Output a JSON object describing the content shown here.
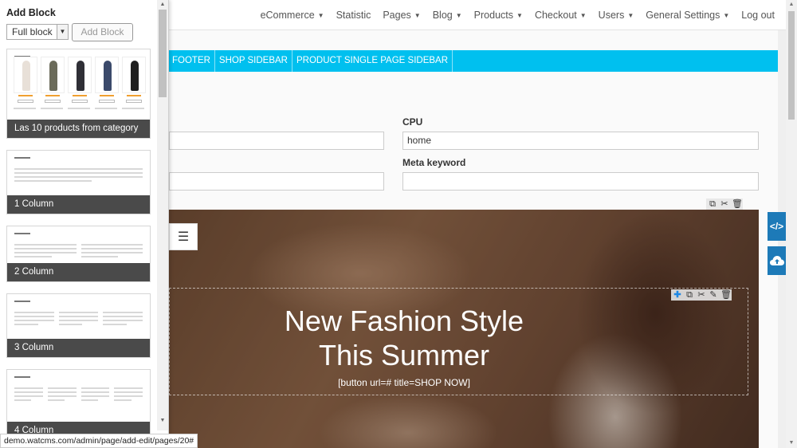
{
  "topnav": {
    "items": [
      {
        "label": "eCommerce",
        "dropdown": true
      },
      {
        "label": "Statistic",
        "dropdown": false
      },
      {
        "label": "Pages",
        "dropdown": true
      },
      {
        "label": "Blog",
        "dropdown": true
      },
      {
        "label": "Products",
        "dropdown": true
      },
      {
        "label": "Checkout",
        "dropdown": true
      },
      {
        "label": "Users",
        "dropdown": true
      },
      {
        "label": "General Settings",
        "dropdown": true
      },
      {
        "label": "Log out",
        "dropdown": false
      }
    ]
  },
  "tabs": [
    "FOOTER",
    "SHOP SIDEBAR",
    "PRODUCT SINGLE PAGE SIDEBAR"
  ],
  "form": {
    "cpu_label": "CPU",
    "cpu_value": "home",
    "meta_keyword_label": "Meta keyword",
    "meta_keyword_value": ""
  },
  "hero": {
    "title_line1": "New Fashion Style",
    "title_line2": "This Summer",
    "shortcode": "[button url=# title=SHOP NOW]"
  },
  "panel": {
    "title": "Add Block",
    "select_value": "Full block",
    "add_button": "Add Block",
    "blocks": [
      {
        "caption": "Las 10 products from category",
        "kind": "products"
      },
      {
        "caption": "1 Column",
        "kind": "columns",
        "columns": 1
      },
      {
        "caption": "2 Column",
        "kind": "columns",
        "columns": 2
      },
      {
        "caption": "3 Column",
        "kind": "columns",
        "columns": 3
      },
      {
        "caption": "4 Column",
        "kind": "columns",
        "columns": 4
      }
    ]
  },
  "side_buttons": {
    "code_icon": "</>",
    "upload_icon": "cloud-upload-icon"
  },
  "status_url": "demo.watcms.com/admin/page/add-edit/pages/20#",
  "colors": {
    "accent_tab": "#00c0ef",
    "side_button": "#1d7ab8",
    "caption_bg": "#4a4a4a"
  }
}
